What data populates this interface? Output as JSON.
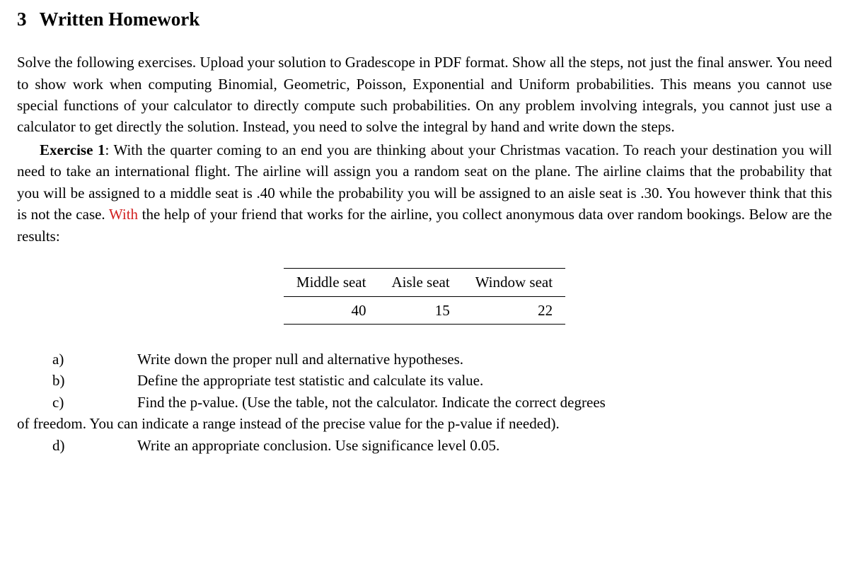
{
  "section": {
    "number": "3",
    "title": "Written Homework"
  },
  "intro": "Solve the following exercises. Upload your solution to Gradescope in PDF format. Show all the steps, not just the final answer. You need to show work when computing Binomial, Geometric, Poisson, Exponential and Uniform probabilities. This means you cannot use special functions of your calculator to directly compute such probabilities. On any problem involving integrals, you cannot just use a calculator to get directly the solution. Instead, you need to solve the integral by hand and write down the steps.",
  "exercise": {
    "label": "Exercise 1",
    "text_pre": ": With the quarter coming to an end you are thinking about your Christmas vacation. To reach your destination you will need to take an international flight. The airline will assign you a random seat on the plane. The airline claims that the probability that you will be assigned to a middle seat is .40 while the probability you will be assigned to an aisle seat is .30. You however think that this is not the case. ",
    "annotated_word": "With",
    "text_post": " the help of your friend that works for the airline, you collect anonymous data over random bookings. Below are the results:"
  },
  "table": {
    "headers": [
      "Middle seat",
      "Aisle seat",
      "Window seat"
    ],
    "values": [
      "40",
      "15",
      "22"
    ]
  },
  "questions": {
    "a": {
      "label": "a)",
      "text": "Write down the proper null and alternative hypotheses."
    },
    "b": {
      "label": "b)",
      "text": "Define the appropriate test statistic and calculate its value."
    },
    "c": {
      "label": "c)",
      "text": "Find the p-value. (Use the table, not the calculator. Indicate the correct degrees",
      "cont": "of freedom. You can indicate a range instead of the precise value for the p-value if needed)."
    },
    "d": {
      "label": "d)",
      "text": "Write an appropriate conclusion. Use significance level 0.05."
    }
  }
}
